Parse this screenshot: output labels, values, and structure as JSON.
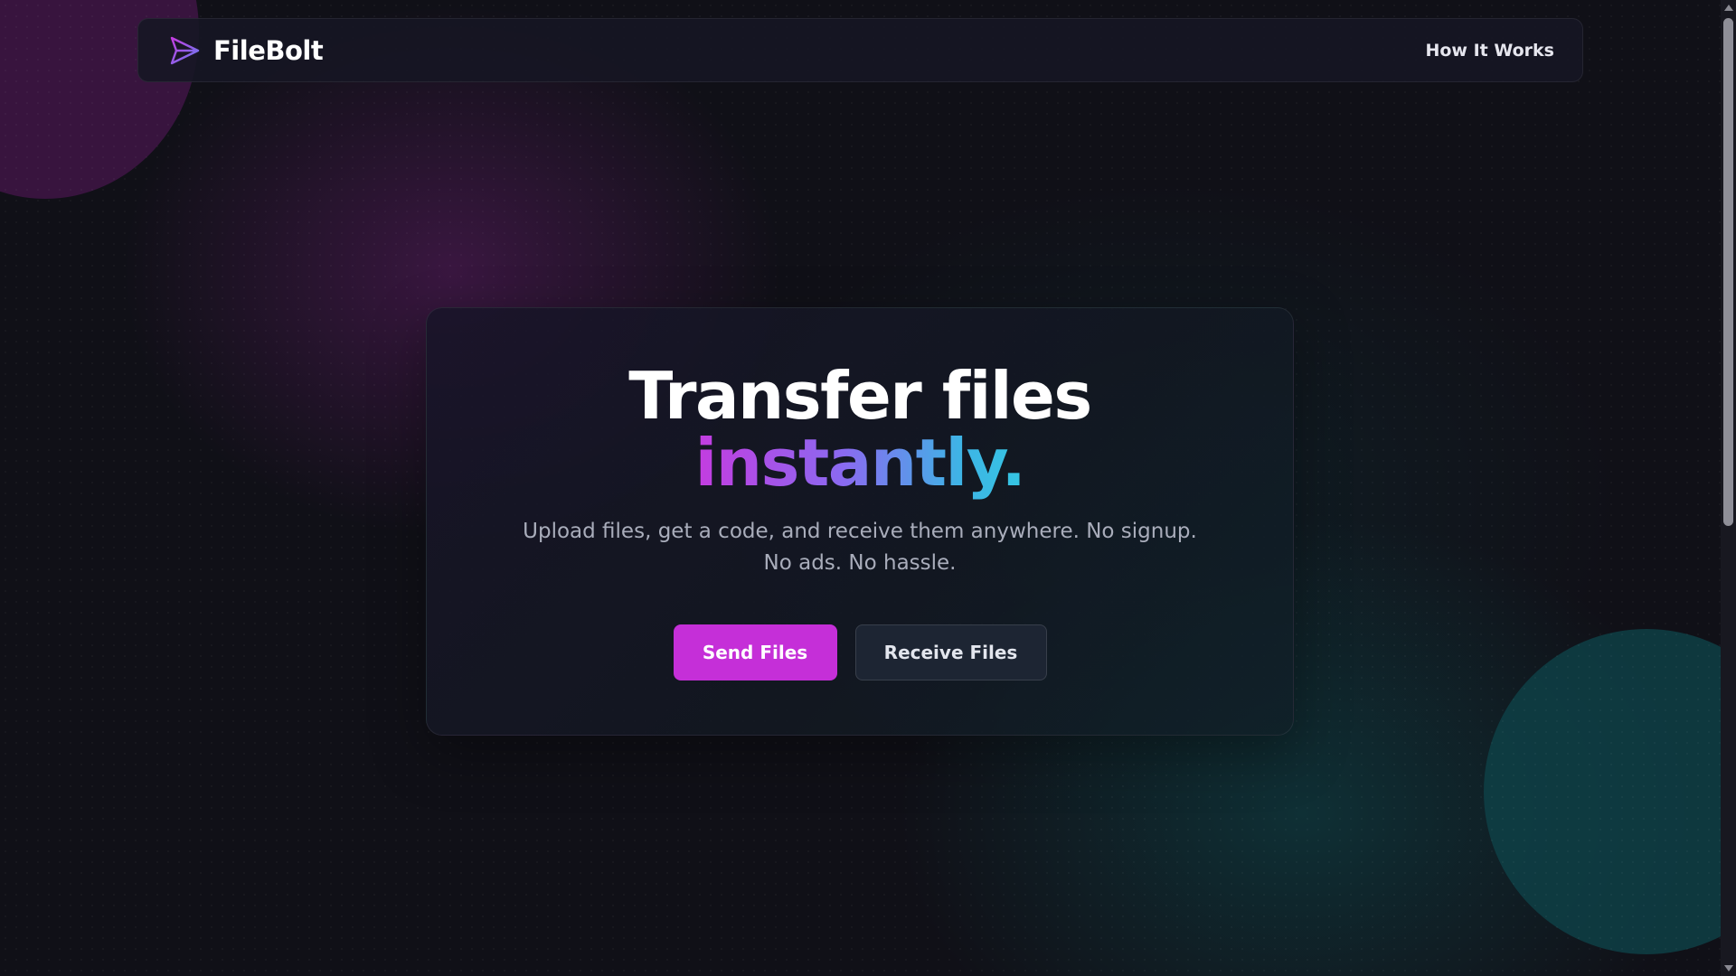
{
  "header": {
    "brand_name": "FileBolt",
    "brand_icon": "paper-plane-icon",
    "nav_link": "How It Works"
  },
  "hero": {
    "headline": "Transfer files",
    "headline_accent": "instantly.",
    "subtitle": "Upload files, get a code, and receive them anywhere. No signup. No ads. No hassle.",
    "primary_button": "Send Files",
    "secondary_button": "Receive Files"
  },
  "colors": {
    "accent": "#c52fd8",
    "gradient_start": "#c43ce0",
    "gradient_mid": "#8a6af0",
    "gradient_end": "#34c6e2",
    "background": "#101017"
  }
}
